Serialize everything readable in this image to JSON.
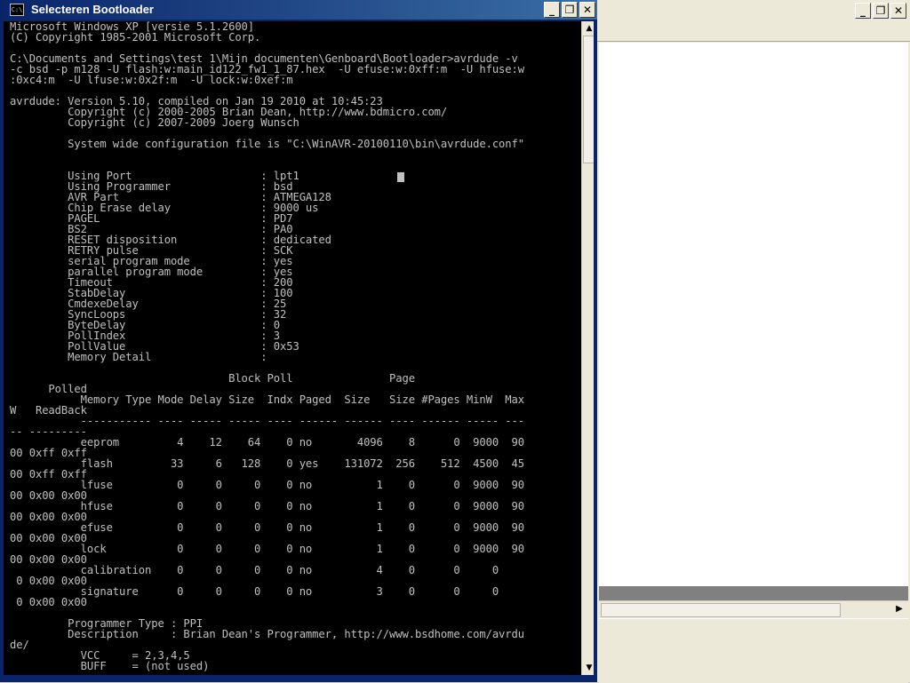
{
  "window": {
    "title": "Selecteren Bootloader",
    "icon_text": "C:\\",
    "minimize_glyph": "_",
    "maximize_glyph": "❐",
    "close_glyph": "✕"
  },
  "background_window": {
    "minimize_glyph": "_",
    "maximize_glyph": "❐",
    "close_glyph": "✕",
    "scroll_right_glyph": "▶"
  },
  "console_lines": [
    "Microsoft Windows XP [versie 5.1.2600]",
    "(C) Copyright 1985-2001 Microsoft Corp.",
    "",
    "C:\\Documents and Settings\\test 1\\Mijn documenten\\Genboard\\Bootloader>avrdude -v",
    "-c bsd -p m128 -U flash:w:main_id122_fw1_1_87.hex  -U efuse:w:0xff:m  -U hfuse:w",
    ":0xc4:m  -U lfuse:w:0x2f:m  -U lock:w:0xef:m",
    "",
    "avrdude: Version 5.10, compiled on Jan 19 2010 at 10:45:23",
    "         Copyright (c) 2000-2005 Brian Dean, http://www.bdmicro.com/",
    "         Copyright (c) 2007-2009 Joerg Wunsch",
    "",
    "         System wide configuration file is \"C:\\WinAVR-20100110\\bin\\avrdude.conf\"",
    "",
    "",
    "         Using Port                    : lpt1",
    "         Using Programmer              : bsd",
    "         AVR Part                      : ATMEGA128",
    "         Chip Erase delay              : 9000 us",
    "         PAGEL                         : PD7",
    "         BS2                           : PA0",
    "         RESET disposition             : dedicated",
    "         RETRY pulse                   : SCK",
    "         serial program mode           : yes",
    "         parallel program mode         : yes",
    "         Timeout                       : 200",
    "         StabDelay                     : 100",
    "         CmdexeDelay                   : 25",
    "         SyncLoops                     : 32",
    "         ByteDelay                     : 0",
    "         PollIndex                     : 3",
    "         PollValue                     : 0x53",
    "         Memory Detail                 :",
    "",
    "                                  Block Poll               Page",
    "      Polled",
    "           Memory Type Mode Delay Size  Indx Paged  Size   Size #Pages MinW  Max",
    "W   ReadBack",
    "           ----------- ---- ----- ----- ---- ------ ------ ---- ------ ----- ---",
    "-- ---------",
    "           eeprom         4    12    64    0 no       4096    8      0  9000  90",
    "00 0xff 0xff",
    "           flash         33     6   128    0 yes    131072  256    512  4500  45",
    "00 0xff 0xff",
    "           lfuse          0     0     0    0 no          1    0      0  9000  90",
    "00 0x00 0x00",
    "           hfuse          0     0     0    0 no          1    0      0  9000  90",
    "00 0x00 0x00",
    "           efuse          0     0     0    0 no          1    0      0  9000  90",
    "00 0x00 0x00",
    "           lock           0     0     0    0 no          1    0      0  9000  90",
    "00 0x00 0x00",
    "           calibration    0     0     0    0 no          4    0      0     0",
    " 0 0x00 0x00",
    "           signature      0     0     0    0 no          3    0      0     0",
    " 0 0x00 0x00",
    "",
    "         Programmer Type : PPI",
    "         Description     : Brian Dean's Programmer, http://www.bsdhome.com/avrdu",
    "de/",
    "           VCC     = 2,3,4,5",
    "           BUFF    = (not used)"
  ],
  "scrollbar": {
    "up_glyph": "▲",
    "down_glyph": "▼"
  }
}
